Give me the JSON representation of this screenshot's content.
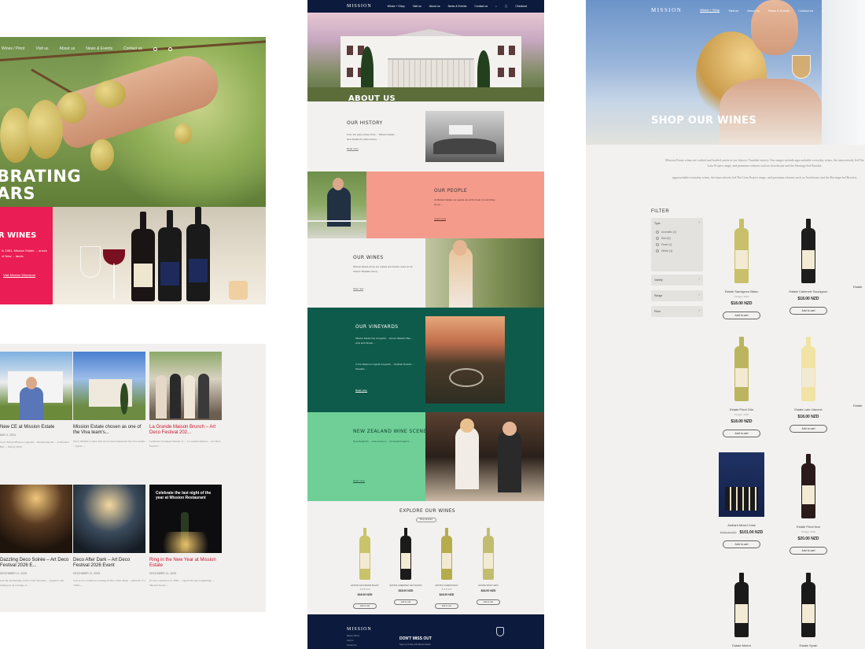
{
  "left": {
    "nav": [
      "Wines / Pinot",
      "Visit us",
      "About us",
      "News & Events",
      "Contact us"
    ],
    "hero_title_line1": "BRATING",
    "hero_title_line2": "ARS",
    "promo_title": "R WINES",
    "promo_text": "In 1851, Mission Estate ... ances of New ... lands",
    "promo_link": "Visit Mission Winestore",
    "news": [
      {
        "title": "New CE at Mission Estate",
        "date": "MAY 2, 2024",
        "excerpt": "Led a Estate Mission a appoint... Introducing the ... at Hawke's Bay ... history 2026",
        "red": false
      },
      {
        "title": "Mission Estate chosen as one of the Viva team's...",
        "date": "",
        "excerpt": "We're thrilled to share that we've been featured in the Viva team's ... guide ...",
        "red": false
      },
      {
        "title": "La Grande Maison Brunch – Art Deco Festival 202...",
        "date": "",
        "excerpt": "Celebrate an elegant Sunday at ... La Grande Maison ... Art Deco Festival ...",
        "red": true
      },
      {
        "title": "Dazzling Deco Soirée – Art Deco Festival 2026 E...",
        "date": "DECEMBER 11, 2025",
        "excerpt": "Join the enchanting world of the Twenties ... elegance and indulge in an evening of ...",
        "red": false
      },
      {
        "title": "Deco After Dark – Art Deco Festival 2026 Event",
        "date": "DECEMBER 11, 2025",
        "excerpt": "Join us for a fabulous evening at Deco After Dark ... glamour of a 1920s ...",
        "red": false
      },
      {
        "title": "Ring in the New Year at Mission Estate",
        "date": "DECEMBER 11, 2025",
        "excerpt": "It's the countdown to 2026 ... ring in the new beginnings ... Mission Estate ...",
        "red": true
      }
    ],
    "news_overlay": "Celebrate the last night of the year at Mission Restaurant"
  },
  "mid": {
    "nav": {
      "logo": "MISSION",
      "items": [
        "Wines + Shop",
        "Visit us",
        "About us",
        "News & Events",
        "Contact us",
        "Checkout"
      ]
    },
    "hero_title": "ABOUT US",
    "history": {
      "title": "OUR HISTORY",
      "text": "From the early arrival of the ... Mission Estate ... New Zealand's oldest winery ...",
      "link": "Read more"
    },
    "people": {
      "title": "OUR PEOPLE",
      "text": "At Mission Estate our people are at the heart of everything we do ...",
      "link": "Learn more"
    },
    "wines": {
      "title": "OUR WINES",
      "text": "Mission Estate wines are crafted and bottled onsite at our historic Taradale winery ...",
      "link": "Shop now"
    },
    "vineyards": {
      "title": "OUR VINEYARDS",
      "text": "Mission Estate has vineyards ... across Hawke's Bay ... soils and climate ...",
      "text2": "In the Mission's original vineyards ... Gimblett Gravels ... Taradale ...",
      "link": "Read more"
    },
    "nzscene": {
      "title": "NEW ZEALAND WINE SCENE",
      "text": "New Zealand's ... wine scene is ... of vineyard regions ...",
      "link": "Read more"
    },
    "explore": {
      "title": "EXPLORE OUR WINES",
      "btn": "Shop all wines"
    },
    "products": [
      {
        "name": "ESTATE SAUVIGNON BLANC",
        "stars": "★★★★★",
        "price": "$18.00 NZD",
        "btn": "Add to cart",
        "color": "#c9c36a"
      },
      {
        "name": "ESTATE CABERNET SAUVIGNON",
        "stars": "",
        "price": "$18.00 NZD",
        "btn": "Add to cart",
        "color": "#1b1b1b"
      },
      {
        "name": "ESTATE CHARDONNAY",
        "stars": "★★★★★",
        "price": "$18.00 NZD",
        "btn": "Add to cart",
        "color": "#b7ac4c"
      },
      {
        "name": "ESTATE PINOT GRIS",
        "stars": "",
        "price": "$18.00 NZD",
        "btn": "Add to cart",
        "color": "#c2bd6e"
      }
    ],
    "footer": {
      "logo": "MISSION",
      "dont_miss": "DON'T MISS OUT",
      "links": [
        "Mission Wines",
        "Visit Us",
        "Contact Us"
      ],
      "sub": "Keep up to date with Mission Estate"
    }
  },
  "right": {
    "nav": {
      "logo": "MISSION",
      "items": [
        "Wines + Shop",
        "Visit us",
        "About us",
        "News & Events",
        "Contact us"
      ]
    },
    "hero_title": "SHOP OUR WINES",
    "intro1": "Mission Estate wines are crafted and bottled onsite at our historic Taradale winery. Our ranges include approachable everyday wines, the innovatively led The Gaia Project range, and premium releases such as Jewelstone and the Heritage-led Bracket.",
    "intro2": "approachable everyday wines, the innovatively led The Gaia Project range, and premium releases such as Jewelstone and the Heritage-led Bracket.",
    "filter": {
      "title": "FILTER",
      "type": "Type",
      "options": [
        "Aromatic (2)",
        "Red (5)",
        "Rosé (1)",
        "White (4)"
      ],
      "groups": [
        "Variety",
        "Range",
        "Price"
      ]
    },
    "products": [
      {
        "name": "Estate Sauvignon Blanc",
        "vintage": "Vintage: 2024",
        "price": "$18.00 NZD",
        "old": "",
        "btn": "Add to cart",
        "color": "#c8c06a"
      },
      {
        "name": "Estate Cabernet Sauvignon",
        "vintage": "",
        "price": "$18.00 NZD",
        "old": "",
        "btn": "Add to cart",
        "color": "#1d1d1d"
      },
      {
        "name": "Estate Pinot Gris",
        "vintage": "Vintage: 2025",
        "price": "$18.00 NZD",
        "old": "",
        "btn": "Add to cart",
        "color": "#bcb560"
      },
      {
        "name": "Estate Late Harvest",
        "vintage": "",
        "price": "$18.00 NZD",
        "old": "",
        "btn": "Add to cart",
        "color": "#f0e3a4"
      },
      {
        "name": "Jubilant Mixed Case",
        "vintage": "",
        "price": "$101.00 NZD",
        "old": "$108.00 NZD",
        "btn": "Add to cart",
        "color": "#1f3263"
      },
      {
        "name": "Estate Pinot Noir",
        "vintage": "Vintage: 2022",
        "price": "$20.00 NZD",
        "old": "",
        "btn": "Add to cart",
        "color": "#2a1a1a"
      },
      {
        "name": "Estate Merlot",
        "vintage": "",
        "price": "",
        "old": "",
        "btn": "",
        "color": "#1a1a1a"
      },
      {
        "name": "Estate Syrah",
        "vintage": "",
        "price": "",
        "old": "",
        "btn": "",
        "color": "#1a1a1a"
      }
    ],
    "edge_labels": [
      "Estate",
      "Estate"
    ]
  },
  "colors": {
    "navy": "#0c1b3d",
    "pink": "#ea1e54",
    "salmon": "#f49b8c",
    "teal": "#0f5b4b",
    "mint": "#6fcf97"
  }
}
